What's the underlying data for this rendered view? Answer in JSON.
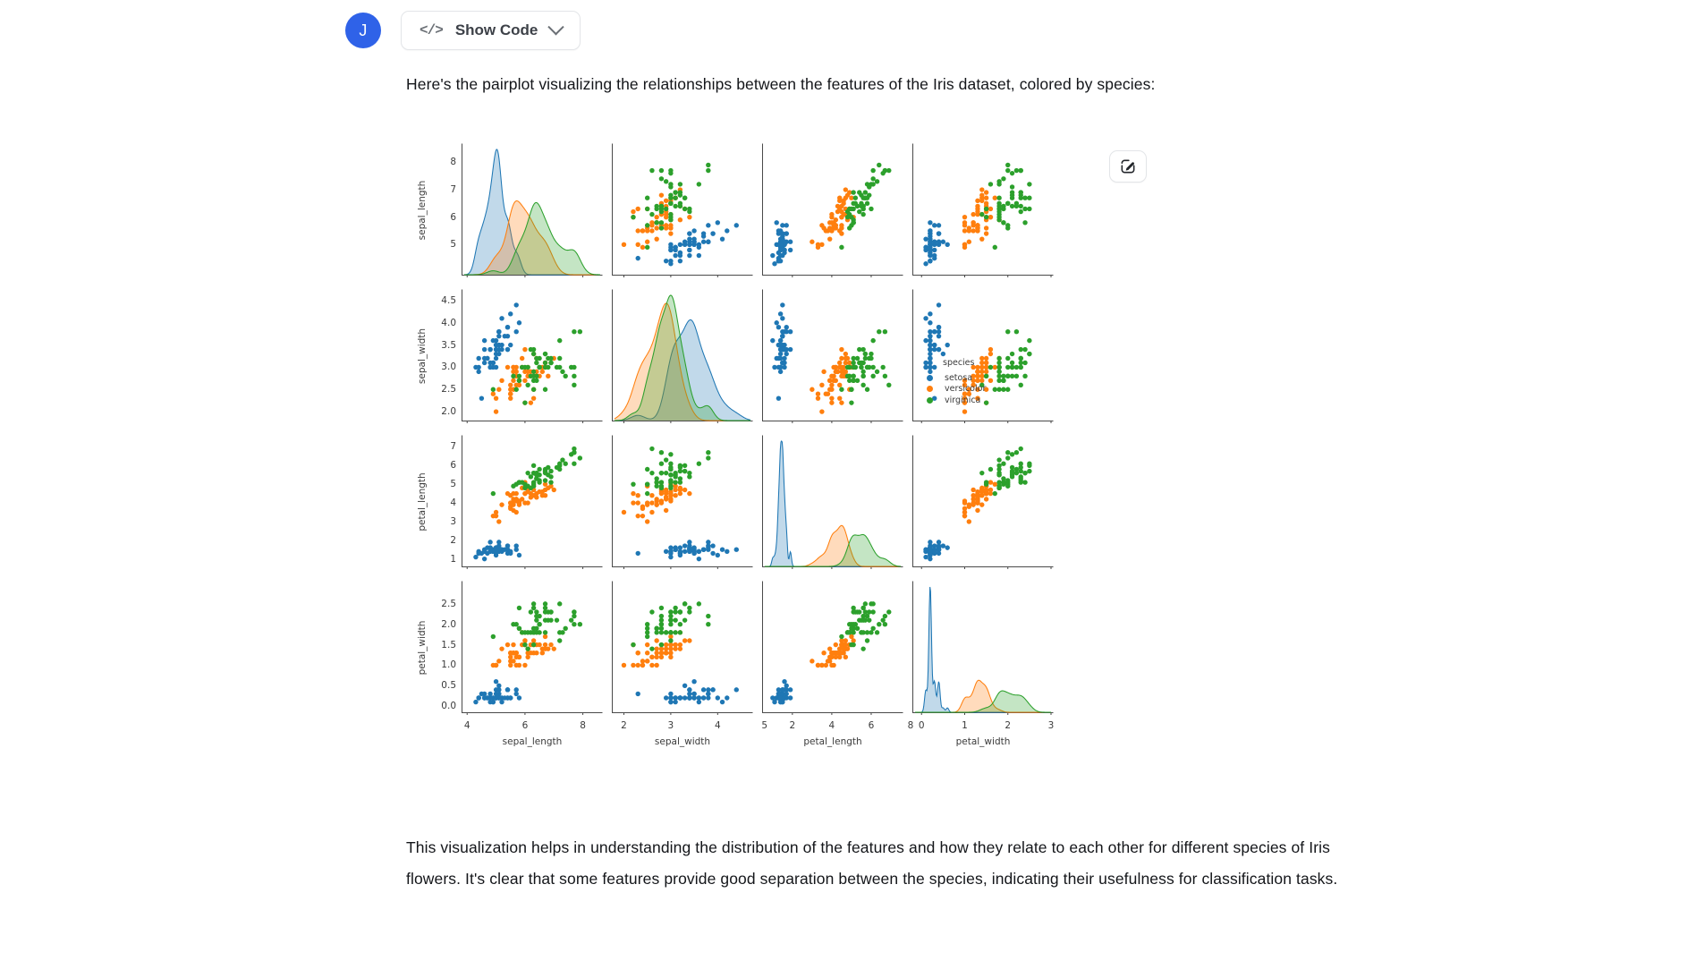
{
  "message": {
    "avatar_initial": "J",
    "show_code_label": "Show Code",
    "code_icon": "code-brackets-icon",
    "chevron_icon": "chevron-down-icon",
    "edit_icon": "edit-square-pencil-icon",
    "intro_text": "Here's the pairplot visualizing the relationships between the features of the Iris dataset, colored by species:",
    "outro_text": "This visualization helps in understanding the distribution of the features and how they relate to each other for different species of Iris flowers. It's clear that some features provide good separation between the species, indicating their usefulness for classification tasks."
  },
  "colors": {
    "avatar_bg": "#2f62e8",
    "setosa": "#1f77b4",
    "versicolor": "#ff7f0e",
    "virginica": "#2ca02c",
    "axis": "#4a4a4a",
    "text": "#3a3a3a"
  },
  "chart_data": {
    "type": "scatter",
    "title": "",
    "plot_kind": "pairplot",
    "grid": false,
    "legend_position": "right",
    "legend_title": "species",
    "variables": [
      "sepal_length",
      "sepal_width",
      "petal_length",
      "petal_width"
    ],
    "hue": "species",
    "classes": [
      {
        "name": "setosa",
        "color": "#1f77b4"
      },
      {
        "name": "versicolor",
        "color": "#ff7f0e"
      },
      {
        "name": "virginica",
        "color": "#2ca02c"
      }
    ],
    "axes": {
      "sepal_length": {
        "ticks": [
          5,
          6,
          7,
          8
        ],
        "tick_labels": [
          "5",
          "6",
          "7",
          "8"
        ],
        "x_ticks": [
          4,
          6,
          8
        ],
        "x_tick_labels": [
          "4",
          "6",
          "8"
        ],
        "lim": [
          3.9,
          8.6
        ]
      },
      "sepal_width": {
        "ticks": [
          2.0,
          2.5,
          3.0,
          3.5,
          4.0,
          4.5
        ],
        "tick_labels": [
          "2.0",
          "2.5",
          "3.0",
          "3.5",
          "4.0",
          "4.5"
        ],
        "x_ticks": [
          2,
          3,
          4,
          5
        ],
        "x_tick_labels": [
          "2",
          "3",
          "4",
          "5"
        ],
        "lim": [
          1.8,
          4.7
        ]
      },
      "petal_length": {
        "ticks": [
          1,
          2,
          3,
          4,
          5,
          6,
          7
        ],
        "tick_labels": [
          "1",
          "2",
          "3",
          "4",
          "5",
          "6",
          "7"
        ],
        "x_ticks": [
          2,
          4,
          6,
          8
        ],
        "x_tick_labels": [
          "2",
          "4",
          "6",
          "8"
        ],
        "lim": [
          0.6,
          7.5
        ]
      },
      "petal_width": {
        "ticks": [
          0.0,
          0.5,
          1.0,
          1.5,
          2.0,
          2.5
        ],
        "tick_labels": [
          "0.0",
          "0.5",
          "1.0",
          "1.5",
          "2.0",
          "2.5"
        ],
        "x_ticks": [
          0,
          1,
          2,
          3
        ],
        "x_tick_labels": [
          "0",
          "1",
          "2",
          "3"
        ],
        "lim": [
          -0.15,
          3.0
        ]
      }
    },
    "diagonal": "kde",
    "points": {
      "setosa": [
        [
          5.1,
          3.5,
          1.4,
          0.2
        ],
        [
          4.9,
          3.0,
          1.4,
          0.2
        ],
        [
          4.7,
          3.2,
          1.3,
          0.2
        ],
        [
          4.6,
          3.1,
          1.5,
          0.2
        ],
        [
          5.0,
          3.6,
          1.4,
          0.2
        ],
        [
          5.4,
          3.9,
          1.7,
          0.4
        ],
        [
          4.6,
          3.4,
          1.4,
          0.3
        ],
        [
          5.0,
          3.4,
          1.5,
          0.2
        ],
        [
          4.4,
          2.9,
          1.4,
          0.2
        ],
        [
          4.9,
          3.1,
          1.5,
          0.1
        ],
        [
          5.4,
          3.7,
          1.5,
          0.2
        ],
        [
          4.8,
          3.4,
          1.6,
          0.2
        ],
        [
          4.8,
          3.0,
          1.4,
          0.1
        ],
        [
          4.3,
          3.0,
          1.1,
          0.1
        ],
        [
          5.8,
          4.0,
          1.2,
          0.2
        ],
        [
          5.7,
          4.4,
          1.5,
          0.4
        ],
        [
          5.4,
          3.9,
          1.3,
          0.4
        ],
        [
          5.1,
          3.5,
          1.4,
          0.3
        ],
        [
          5.7,
          3.8,
          1.7,
          0.3
        ],
        [
          5.1,
          3.8,
          1.5,
          0.3
        ],
        [
          5.4,
          3.4,
          1.7,
          0.2
        ],
        [
          5.1,
          3.7,
          1.5,
          0.4
        ],
        [
          4.6,
          3.6,
          1.0,
          0.2
        ],
        [
          5.1,
          3.3,
          1.7,
          0.5
        ],
        [
          4.8,
          3.4,
          1.9,
          0.2
        ],
        [
          5.0,
          3.0,
          1.6,
          0.2
        ],
        [
          5.0,
          3.4,
          1.6,
          0.4
        ],
        [
          5.2,
          3.5,
          1.5,
          0.2
        ],
        [
          5.2,
          3.4,
          1.4,
          0.2
        ],
        [
          4.7,
          3.2,
          1.6,
          0.2
        ],
        [
          4.8,
          3.1,
          1.6,
          0.2
        ],
        [
          5.4,
          3.4,
          1.5,
          0.4
        ],
        [
          5.2,
          4.1,
          1.5,
          0.1
        ],
        [
          5.5,
          4.2,
          1.4,
          0.2
        ],
        [
          4.9,
          3.1,
          1.5,
          0.2
        ],
        [
          5.0,
          3.2,
          1.2,
          0.2
        ],
        [
          5.5,
          3.5,
          1.3,
          0.2
        ],
        [
          4.9,
          3.6,
          1.4,
          0.1
        ],
        [
          4.4,
          3.0,
          1.3,
          0.2
        ],
        [
          5.1,
          3.4,
          1.5,
          0.2
        ],
        [
          5.0,
          3.5,
          1.3,
          0.3
        ],
        [
          4.5,
          2.3,
          1.3,
          0.3
        ],
        [
          4.4,
          3.2,
          1.3,
          0.2
        ],
        [
          5.0,
          3.5,
          1.6,
          0.6
        ],
        [
          5.1,
          3.8,
          1.9,
          0.4
        ],
        [
          4.8,
          3.0,
          1.4,
          0.3
        ],
        [
          5.1,
          3.8,
          1.6,
          0.2
        ],
        [
          4.6,
          3.2,
          1.4,
          0.2
        ],
        [
          5.3,
          3.7,
          1.5,
          0.2
        ],
        [
          5.0,
          3.3,
          1.4,
          0.2
        ]
      ],
      "versicolor": [
        [
          7.0,
          3.2,
          4.7,
          1.4
        ],
        [
          6.4,
          3.2,
          4.5,
          1.5
        ],
        [
          6.9,
          3.1,
          4.9,
          1.5
        ],
        [
          5.5,
          2.3,
          4.0,
          1.3
        ],
        [
          6.5,
          2.8,
          4.6,
          1.5
        ],
        [
          5.7,
          2.8,
          4.5,
          1.3
        ],
        [
          6.3,
          3.3,
          4.7,
          1.6
        ],
        [
          4.9,
          2.4,
          3.3,
          1.0
        ],
        [
          6.6,
          2.9,
          4.6,
          1.3
        ],
        [
          5.2,
          2.7,
          3.9,
          1.4
        ],
        [
          5.0,
          2.0,
          3.5,
          1.0
        ],
        [
          5.9,
          3.0,
          4.2,
          1.5
        ],
        [
          6.0,
          2.2,
          4.0,
          1.0
        ],
        [
          6.1,
          2.9,
          4.7,
          1.4
        ],
        [
          5.6,
          2.9,
          3.6,
          1.3
        ],
        [
          6.7,
          3.1,
          4.4,
          1.4
        ],
        [
          5.6,
          3.0,
          4.5,
          1.5
        ],
        [
          5.8,
          2.7,
          4.1,
          1.0
        ],
        [
          6.2,
          2.2,
          4.5,
          1.5
        ],
        [
          5.6,
          2.5,
          3.9,
          1.1
        ],
        [
          5.9,
          3.2,
          4.8,
          1.8
        ],
        [
          6.1,
          2.8,
          4.0,
          1.3
        ],
        [
          6.3,
          2.5,
          4.9,
          1.5
        ],
        [
          6.1,
          2.8,
          4.7,
          1.2
        ],
        [
          6.4,
          2.9,
          4.3,
          1.3
        ],
        [
          6.6,
          3.0,
          4.4,
          1.4
        ],
        [
          6.8,
          2.8,
          4.8,
          1.4
        ],
        [
          6.7,
          3.0,
          5.0,
          1.7
        ],
        [
          6.0,
          2.9,
          4.5,
          1.5
        ],
        [
          5.7,
          2.6,
          3.5,
          1.0
        ],
        [
          5.5,
          2.4,
          3.8,
          1.1
        ],
        [
          5.5,
          2.4,
          3.7,
          1.0
        ],
        [
          5.8,
          2.7,
          3.9,
          1.2
        ],
        [
          6.0,
          2.7,
          5.1,
          1.6
        ],
        [
          5.4,
          3.0,
          4.5,
          1.5
        ],
        [
          6.0,
          3.4,
          4.5,
          1.6
        ],
        [
          6.7,
          3.1,
          4.7,
          1.5
        ],
        [
          6.3,
          2.3,
          4.4,
          1.3
        ],
        [
          5.6,
          3.0,
          4.1,
          1.3
        ],
        [
          5.5,
          2.5,
          4.0,
          1.3
        ],
        [
          5.5,
          2.6,
          4.4,
          1.2
        ],
        [
          6.1,
          3.0,
          4.6,
          1.4
        ],
        [
          5.8,
          2.6,
          4.0,
          1.2
        ],
        [
          5.0,
          2.3,
          3.3,
          1.0
        ],
        [
          5.6,
          2.7,
          4.2,
          1.3
        ],
        [
          5.7,
          3.0,
          4.2,
          1.2
        ],
        [
          5.7,
          2.9,
          4.2,
          1.3
        ],
        [
          6.2,
          2.9,
          4.3,
          1.3
        ],
        [
          5.1,
          2.5,
          3.0,
          1.1
        ],
        [
          5.7,
          2.8,
          4.1,
          1.3
        ]
      ],
      "virginica": [
        [
          6.3,
          3.3,
          6.0,
          2.5
        ],
        [
          5.8,
          2.7,
          5.1,
          1.9
        ],
        [
          7.1,
          3.0,
          5.9,
          2.1
        ],
        [
          6.3,
          2.9,
          5.6,
          1.8
        ],
        [
          6.5,
          3.0,
          5.8,
          2.2
        ],
        [
          7.6,
          3.0,
          6.6,
          2.1
        ],
        [
          4.9,
          2.5,
          4.5,
          1.7
        ],
        [
          7.3,
          2.9,
          6.3,
          1.8
        ],
        [
          6.7,
          2.5,
          5.8,
          1.8
        ],
        [
          7.2,
          3.6,
          6.1,
          2.5
        ],
        [
          6.5,
          3.2,
          5.1,
          2.0
        ],
        [
          6.4,
          2.7,
          5.3,
          1.9
        ],
        [
          6.8,
          3.0,
          5.5,
          2.1
        ],
        [
          5.7,
          2.5,
          5.0,
          2.0
        ],
        [
          5.8,
          2.8,
          5.1,
          2.4
        ],
        [
          6.4,
          3.2,
          5.3,
          2.3
        ],
        [
          6.5,
          3.0,
          5.5,
          1.8
        ],
        [
          7.7,
          3.8,
          6.7,
          2.2
        ],
        [
          7.7,
          2.6,
          6.9,
          2.3
        ],
        [
          6.0,
          2.2,
          5.0,
          1.5
        ],
        [
          6.9,
          3.2,
          5.7,
          2.3
        ],
        [
          5.6,
          2.8,
          4.9,
          2.0
        ],
        [
          7.7,
          2.8,
          6.7,
          2.0
        ],
        [
          6.3,
          2.7,
          4.9,
          1.8
        ],
        [
          6.7,
          3.3,
          5.7,
          2.1
        ],
        [
          7.2,
          3.2,
          6.0,
          1.8
        ],
        [
          6.2,
          2.8,
          4.8,
          1.8
        ],
        [
          6.1,
          3.0,
          4.9,
          1.8
        ],
        [
          6.4,
          2.8,
          5.6,
          2.1
        ],
        [
          7.2,
          3.0,
          5.8,
          1.6
        ],
        [
          7.4,
          2.8,
          6.1,
          1.9
        ],
        [
          7.9,
          3.8,
          6.4,
          2.0
        ],
        [
          6.4,
          2.8,
          5.6,
          2.2
        ],
        [
          6.3,
          2.8,
          5.1,
          1.5
        ],
        [
          6.1,
          2.6,
          5.6,
          1.4
        ],
        [
          7.7,
          3.0,
          6.1,
          2.3
        ],
        [
          6.3,
          3.4,
          5.6,
          2.4
        ],
        [
          6.4,
          3.1,
          5.5,
          1.8
        ],
        [
          6.0,
          3.0,
          4.8,
          1.8
        ],
        [
          6.9,
          3.1,
          5.4,
          2.1
        ],
        [
          6.7,
          3.1,
          5.6,
          2.4
        ],
        [
          6.9,
          3.1,
          5.1,
          2.3
        ],
        [
          5.8,
          2.7,
          5.1,
          1.9
        ],
        [
          6.8,
          3.2,
          5.9,
          2.3
        ],
        [
          6.7,
          3.3,
          5.7,
          2.5
        ],
        [
          6.7,
          3.0,
          5.2,
          2.3
        ],
        [
          6.3,
          2.5,
          5.0,
          1.9
        ],
        [
          6.5,
          3.0,
          5.2,
          2.0
        ],
        [
          6.2,
          3.4,
          5.4,
          2.3
        ],
        [
          5.9,
          3.0,
          5.1,
          1.8
        ]
      ]
    }
  }
}
